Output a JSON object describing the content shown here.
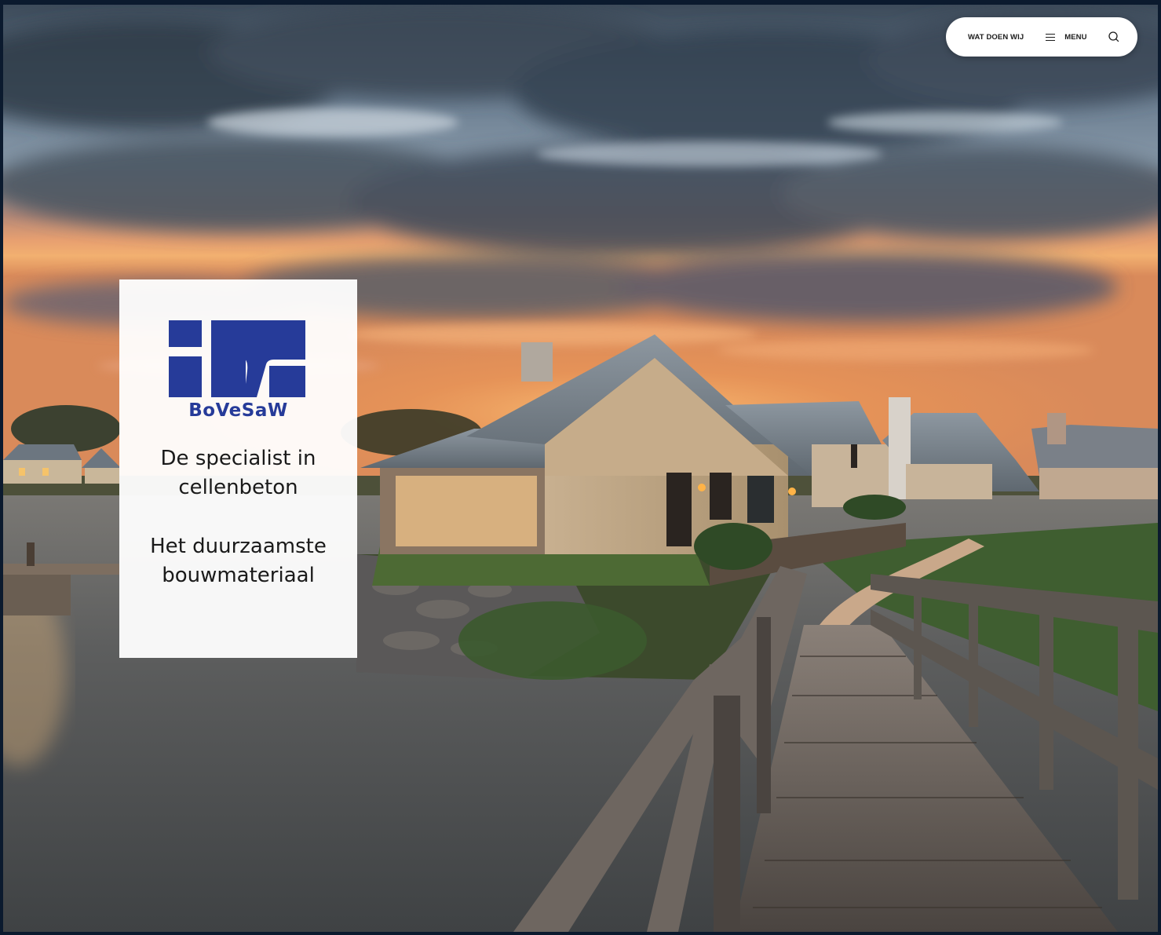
{
  "nav": {
    "what_we_do": "WAT DOEN WIJ",
    "menu": "MENU",
    "search_icon": "search-icon",
    "menu_icon": "hamburger-icon"
  },
  "brand": {
    "name": "BoVeSaW",
    "logo_color": "#263b99"
  },
  "hero": {
    "tagline_1_line_1": "De specialist in",
    "tagline_1_line_2": "cellenbeton",
    "tagline_2_line_1": "Het duurzaamste",
    "tagline_2_line_2": "bouwmateriaal"
  }
}
